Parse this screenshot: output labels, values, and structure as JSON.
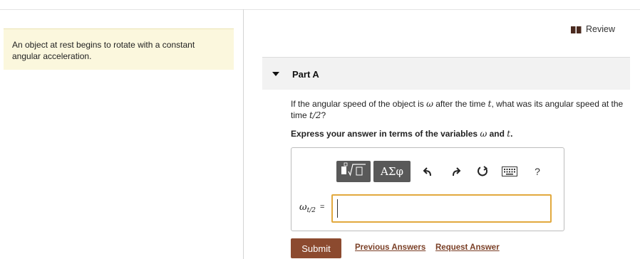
{
  "left_panel": {
    "intro_text": "An object at rest begins to rotate with a constant angular acceleration."
  },
  "header": {
    "review_label": "Review"
  },
  "part": {
    "title": "Part A",
    "question_prefix": "If the angular speed of the object is ",
    "question_var_omega": "ω",
    "question_middle": " after the time ",
    "question_var_t": "t",
    "question_suffix_1": ", what was its angular speed at the time ",
    "question_expr": "t/2",
    "question_end": "?",
    "instruction_prefix": "Express your answer in terms of the variables ",
    "instruction_var_omega": "ω",
    "instruction_and": " and ",
    "instruction_var_t": "t",
    "instruction_end": "."
  },
  "toolbar": {
    "symbols_label": "ΑΣφ",
    "help_label": "?",
    "icons": [
      "templates-icon",
      "undo-icon",
      "redo-icon",
      "reset-icon",
      "keyboard-icon",
      "help-icon"
    ]
  },
  "answer": {
    "variable": "ω",
    "variable_subscript": "t/2",
    "equals": "=",
    "value": ""
  },
  "actions": {
    "submit_label": "Submit",
    "previous_answers_label": "Previous Answers",
    "request_answer_label": "Request Answer"
  },
  "colors": {
    "intro_bg": "#fbf7dd",
    "submit_bg": "#8c4a2f",
    "link": "#7a3f26",
    "input_focus_border": "#e2a93e",
    "toolbar_button_bg": "#595959"
  }
}
